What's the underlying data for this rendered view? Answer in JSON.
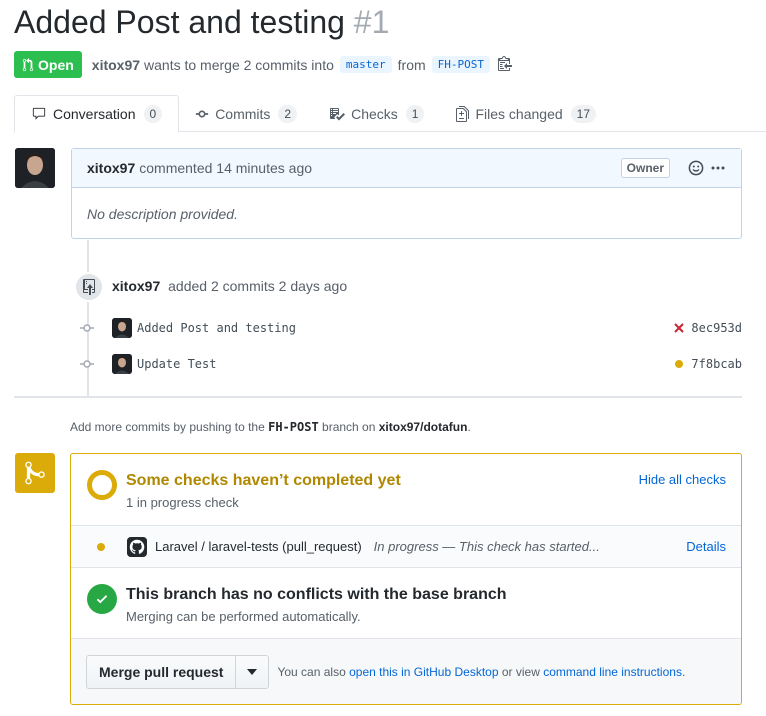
{
  "pr": {
    "title": "Added Post and testing",
    "number": "#1",
    "state": "Open",
    "author": "xitox97",
    "merge_text": "wants to merge 2 commits into",
    "base_branch": "master",
    "from_text": "from",
    "head_branch": "FH-POST"
  },
  "tabs": [
    {
      "label": "Conversation",
      "count": "0",
      "icon": "comment-icon"
    },
    {
      "label": "Commits",
      "count": "2",
      "icon": "commit-icon"
    },
    {
      "label": "Checks",
      "count": "1",
      "icon": "checklist-icon"
    },
    {
      "label": "Files changed",
      "count": "17",
      "icon": "file-diff-icon"
    }
  ],
  "comment": {
    "author": "xitox97",
    "action": "commented 14 minutes ago",
    "badge": "Owner",
    "body": "No description provided."
  },
  "commits_event": {
    "author": "xitox97",
    "text": "added 2 commits 2 days ago",
    "items": [
      {
        "message": "Added Post and testing",
        "sha": "8ec953d",
        "status": "failure",
        "status_color": "#cb2431"
      },
      {
        "message": "Update Test",
        "sha": "7f8bcab",
        "status": "pending",
        "status_color": "#dbab09"
      }
    ]
  },
  "push_hint": {
    "prefix": "Add more commits by pushing to the",
    "branch": "FH-POST",
    "middle": "branch on",
    "repo": "xitox97/dotafun",
    "suffix": "."
  },
  "merge_box": {
    "checks_title": "Some checks haven’t completed yet",
    "checks_sub": "1 in progress check",
    "hide_link": "Hide all checks",
    "check": {
      "name": "Laravel / laravel-tests (pull_request)",
      "desc": "In progress — This check has started...",
      "details": "Details"
    },
    "noconf_title": "This branch has no conflicts with the base branch",
    "noconf_sub": "Merging can be performed automatically.",
    "merge_button": "Merge pull request",
    "also_prefix": "You can also",
    "also_link1": "open this in GitHub Desktop",
    "also_middle": "or view",
    "also_link2": "command line instructions",
    "also_suffix": "."
  },
  "colors": {
    "open_green": "#2cbe4e",
    "link_blue": "#0366d6",
    "pending_yellow": "#dbab09",
    "success_green": "#28a745"
  }
}
